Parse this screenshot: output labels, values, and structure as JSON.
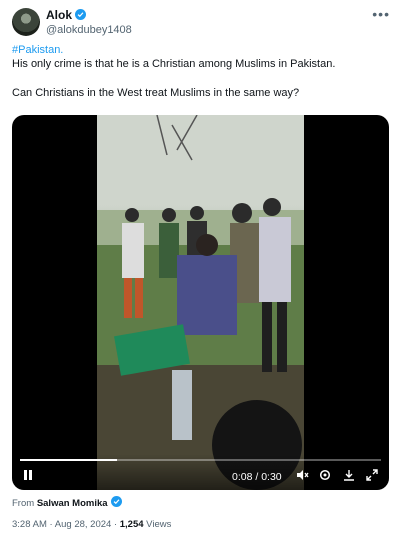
{
  "author": {
    "name": "Alok",
    "handle": "@alokdubey1408",
    "verified": true,
    "more_icon": "more-horizontal-icon"
  },
  "tweet": {
    "hashtag": "#Pakistan.",
    "line1": "His only crime is that he is a Christian among Muslims in Pakistan.",
    "line2": "Can Christians in the West treat Muslims in the same way?"
  },
  "video": {
    "time": "0:08 / 0:30",
    "progress_fraction": 0.27,
    "icons": [
      "pause-icon",
      "volume-muted-icon",
      "settings-gear-icon",
      "download-icon",
      "fullscreen-icon"
    ]
  },
  "source": {
    "prefix": "From",
    "name": "Salwan Momika"
  },
  "meta": {
    "time_date": "3:28 AM · Aug 28, 2024 ·",
    "views_count": "1,254",
    "views_label": "Views"
  },
  "colors": {
    "accent": "#1d9bf0",
    "text": "#0f1419",
    "muted": "#536471"
  }
}
